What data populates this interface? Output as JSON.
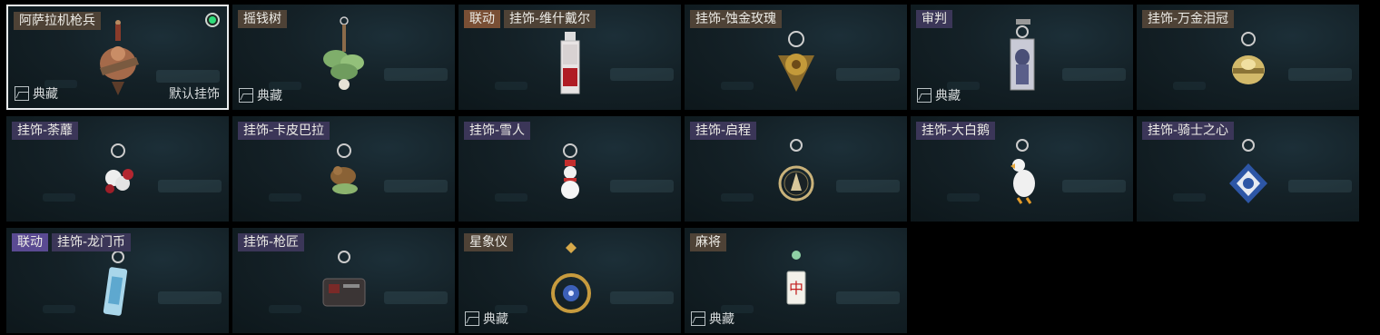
{
  "items": [
    {
      "tags": [
        {
          "text": "阿萨拉机枪兵",
          "style": "brown"
        }
      ],
      "selected": true,
      "equipped": true,
      "collect": "典藏",
      "default": "默认挂饰",
      "charm": "warrior-charm-icon"
    },
    {
      "tags": [
        {
          "text": "摇钱树",
          "style": "brown"
        }
      ],
      "collect": "典藏",
      "charm": "money-tree-charm-icon"
    },
    {
      "tags": [
        {
          "text": "联动",
          "style": "orange"
        },
        {
          "text": "挂饰-维什戴尔",
          "style": "brown"
        }
      ],
      "charm": "red-card-charm-icon"
    },
    {
      "tags": [
        {
          "text": "挂饰-蚀金玫瑰",
          "style": "brown"
        }
      ],
      "charm": "gold-rose-charm-icon"
    },
    {
      "tags": [
        {
          "text": "审判",
          "style": "purple"
        }
      ],
      "collect": "典藏",
      "charm": "judge-card-charm-icon"
    },
    {
      "tags": [
        {
          "text": "挂饰-万金泪冠",
          "style": "brown"
        }
      ],
      "charm": "gold-crown-charm-icon"
    },
    {
      "tags": [
        {
          "text": "挂饰-荼蘼",
          "style": "purple"
        }
      ],
      "charm": "flower-charm-icon"
    },
    {
      "tags": [
        {
          "text": "挂饰-卡皮巴拉",
          "style": "purple"
        }
      ],
      "charm": "capybara-charm-icon"
    },
    {
      "tags": [
        {
          "text": "挂饰-雪人",
          "style": "purple"
        }
      ],
      "charm": "snowman-charm-icon"
    },
    {
      "tags": [
        {
          "text": "挂饰-启程",
          "style": "purple"
        }
      ],
      "charm": "compass-charm-icon"
    },
    {
      "tags": [
        {
          "text": "挂饰-大白鹅",
          "style": "purple"
        }
      ],
      "charm": "goose-charm-icon"
    },
    {
      "tags": [
        {
          "text": "挂饰-骑士之心",
          "style": "purple"
        }
      ],
      "charm": "knight-heart-charm-icon"
    },
    {
      "tags": [
        {
          "text": "联动",
          "style": "violet"
        },
        {
          "text": "挂饰-龙门币",
          "style": "purple"
        }
      ],
      "charm": "coin-card-charm-icon"
    },
    {
      "tags": [
        {
          "text": "挂饰-枪匠",
          "style": "purple"
        }
      ],
      "charm": "gunsmith-box-charm-icon"
    },
    {
      "tags": [
        {
          "text": "星象仪",
          "style": "brown"
        }
      ],
      "collect": "典藏",
      "charm": "astrolabe-charm-icon"
    },
    {
      "tags": [
        {
          "text": "麻将",
          "style": "brown"
        }
      ],
      "collect": "典藏",
      "charm": "mahjong-charm-icon"
    }
  ],
  "mahjong_glyph": "中"
}
